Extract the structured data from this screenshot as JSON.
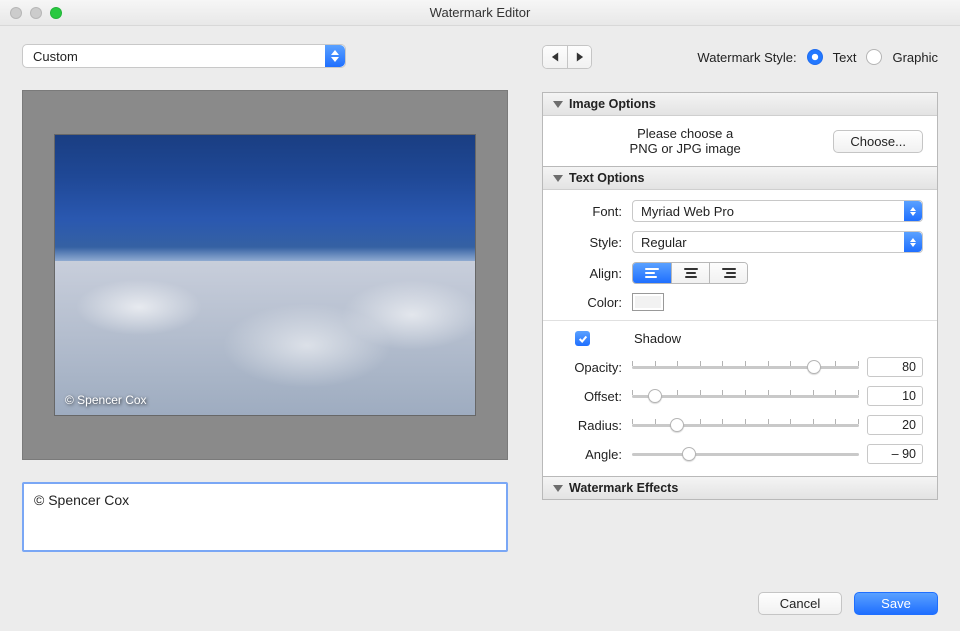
{
  "window": {
    "title": "Watermark Editor"
  },
  "preset": {
    "selected": "Custom"
  },
  "style_label": "Watermark Style:",
  "style": {
    "text": "Text",
    "graphic": "Graphic",
    "selected": "text"
  },
  "panels": {
    "image": {
      "title": "Image Options",
      "hint_line1": "Please choose a",
      "hint_line2": "PNG or JPG image",
      "choose": "Choose..."
    },
    "text": {
      "title": "Text Options",
      "font_label": "Font:",
      "font_value": "Myriad Web Pro",
      "style_label": "Style:",
      "style_value": "Regular",
      "align_label": "Align:",
      "color_label": "Color:",
      "shadow": {
        "enabled": true,
        "label": "Shadow",
        "opacity_label": "Opacity:",
        "opacity": 80,
        "offset_label": "Offset:",
        "offset": 10,
        "radius_label": "Radius:",
        "radius": 20,
        "angle_label": "Angle:",
        "angle": "– 90"
      }
    },
    "effects": {
      "title": "Watermark Effects"
    }
  },
  "watermark_text": "© Spencer Cox",
  "preview_watermark": "© Spencer Cox",
  "buttons": {
    "cancel": "Cancel",
    "save": "Save"
  }
}
